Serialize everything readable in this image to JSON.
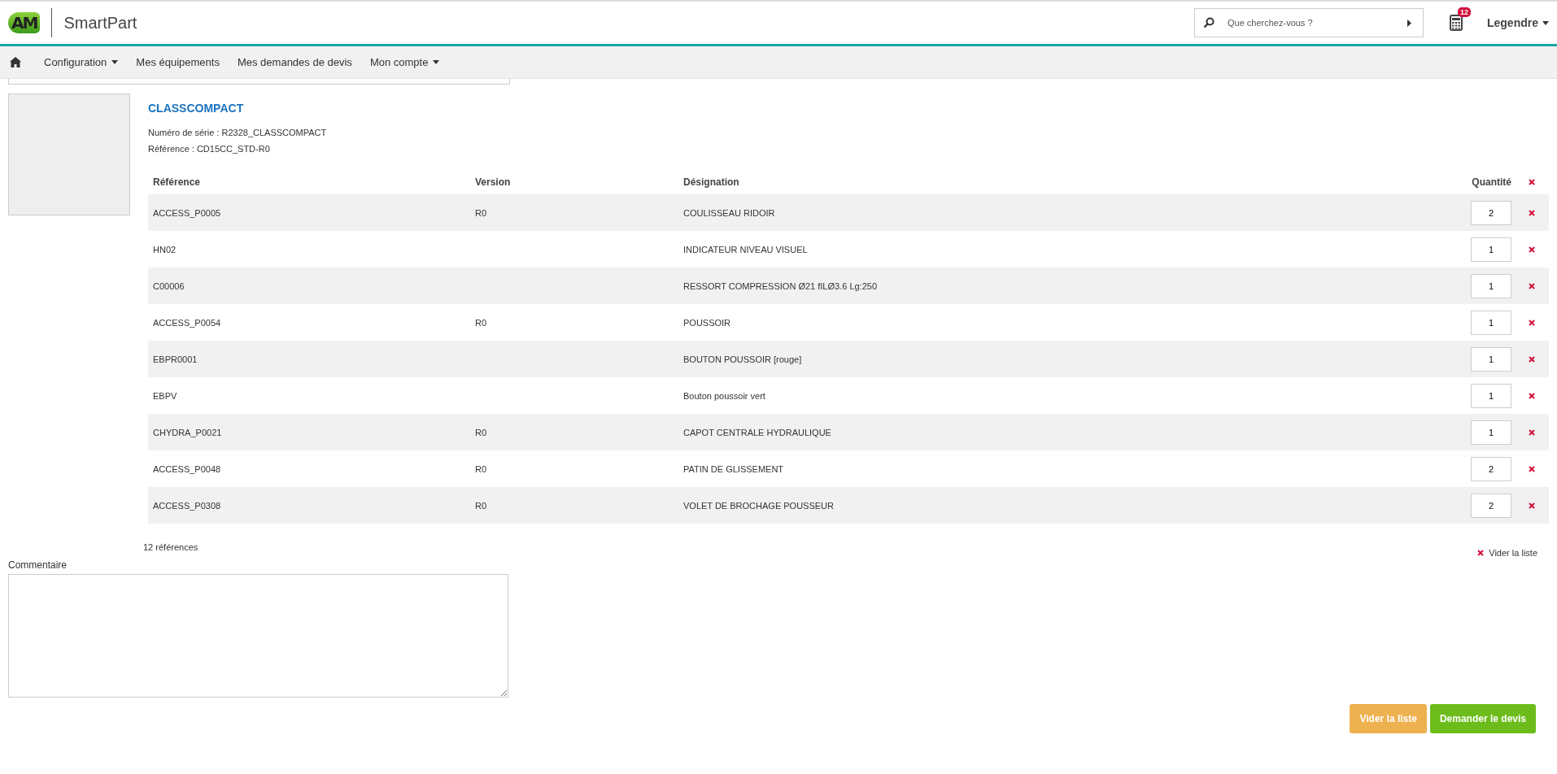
{
  "header": {
    "logo": "AM",
    "app_name": "SmartPart",
    "search": {
      "placeholder": "Que cherchez-vous ?"
    },
    "cart_badge": "12",
    "user": "Legendre"
  },
  "nav": [
    {
      "label": "Configuration",
      "dropdown": true
    },
    {
      "label": "Mes équipements",
      "dropdown": false
    },
    {
      "label": "Mes demandes de devis",
      "dropdown": false
    },
    {
      "label": "Mon compte",
      "dropdown": true
    }
  ],
  "product": {
    "title": "CLASSCOMPACT",
    "serial": "Numéro de série : R2328_CLASSCOMPACT",
    "reference": "Référence : CD15CC_STD-R0"
  },
  "table": {
    "columns": [
      "Référence",
      "Version",
      "Désignation",
      "Quantité"
    ],
    "rows": [
      {
        "reference": "ACCESS_P0005",
        "version": "R0",
        "designation": "COULISSEAU RIDOIR",
        "quantity": "2"
      },
      {
        "reference": "HN02",
        "version": "",
        "designation": "INDICATEUR NIVEAU VISUEL",
        "quantity": "1"
      },
      {
        "reference": "C00006",
        "version": "",
        "designation": "RESSORT COMPRESSION Ø21 fILØ3.6 Lg:250",
        "quantity": "1"
      },
      {
        "reference": "ACCESS_P0054",
        "version": "R0",
        "designation": "POUSSOIR",
        "quantity": "1"
      },
      {
        "reference": "EBPR0001",
        "version": "",
        "designation": "BOUTON POUSSOIR [rouge]",
        "quantity": "1"
      },
      {
        "reference": "EBPV",
        "version": "",
        "designation": "Bouton poussoir vert",
        "quantity": "1"
      },
      {
        "reference": "CHYDRA_P0021",
        "version": "R0",
        "designation": "CAPOT CENTRALE HYDRAULIQUE",
        "quantity": "1"
      },
      {
        "reference": "ACCESS_P0048",
        "version": "R0",
        "designation": "PATIN DE GLISSEMENT",
        "quantity": "2"
      },
      {
        "reference": "ACCESS_P0308",
        "version": "R0",
        "designation": "VOLET DE BROCHAGE POUSSEUR",
        "quantity": "2"
      }
    ]
  },
  "count": "12 références",
  "clear_link": "Vider la liste",
  "comment_label": "Commentaire",
  "buttons": [
    {
      "label": "Vider la liste",
      "kind": "warning"
    },
    {
      "label": "Demander le devis",
      "kind": "primary"
    }
  ]
}
